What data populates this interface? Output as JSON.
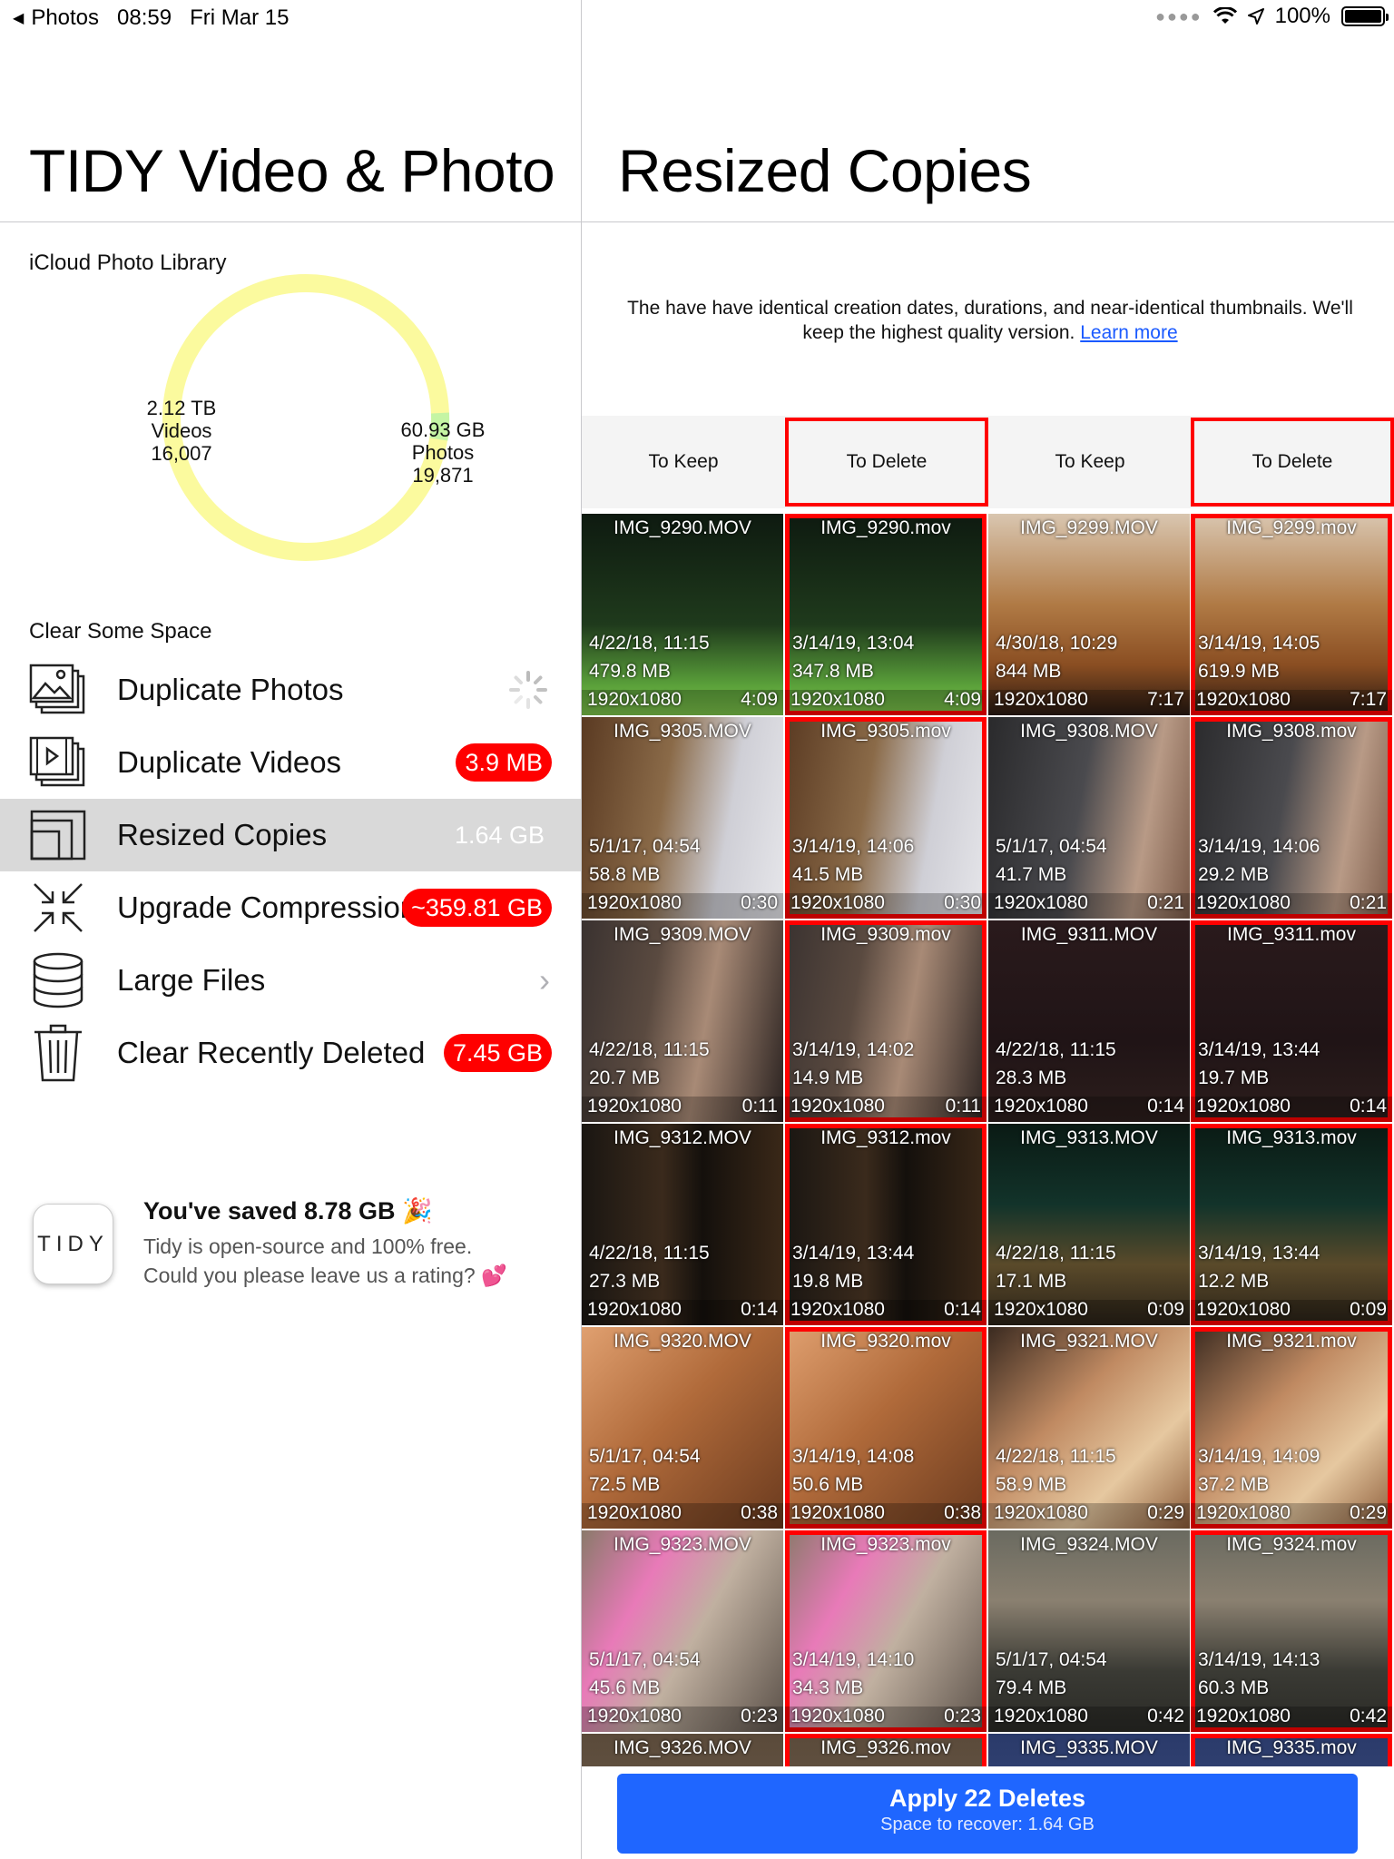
{
  "statusbar": {
    "back_app": "Photos",
    "time": "08:59",
    "date": "Fri Mar 15",
    "battery": "100%"
  },
  "left": {
    "title": "TIDY Video & Photo",
    "library_label": "iCloud Photo Library",
    "donut": {
      "videos_size": "2.12 TB",
      "videos_label": "Videos",
      "videos_count": "16,007",
      "photos_size": "60.93 GB",
      "photos_label": "Photos",
      "photos_count": "19,871",
      "colors": {
        "videos": "#fbfa9e",
        "photos": "#c5f5a4"
      }
    },
    "section_label": "Clear Some Space",
    "menu": [
      {
        "label": "Duplicate Photos",
        "badge": "",
        "icon": "photo-stack-icon"
      },
      {
        "label": "Duplicate Videos",
        "badge": "3.9 MB",
        "icon": "video-stack-icon"
      },
      {
        "label": "Resized Copies",
        "badge": "1.64 GB",
        "icon": "resize-icon"
      },
      {
        "label": "Upgrade Compression",
        "badge": "~359.81 GB",
        "icon": "compress-icon"
      },
      {
        "label": "Large Files",
        "badge": "",
        "icon": "database-icon"
      },
      {
        "label": "Clear Recently Deleted",
        "badge": "7.45 GB",
        "icon": "trash-icon"
      }
    ],
    "rating": {
      "logo_text": "TIDY",
      "title": "You've saved 8.78 GB 🎉",
      "line1": "Tidy is open-source and 100% free.",
      "line2": "Could you please leave us a rating? 💕"
    }
  },
  "right": {
    "title": "Resized Copies",
    "description": "The have have identical creation dates, durations, and near-identical thumbnails. We'll keep the highest quality version.",
    "learn_more": "Learn more",
    "columns": [
      "To Keep",
      "To Delete",
      "To Keep",
      "To Delete"
    ],
    "tiles": [
      {
        "name": "IMG_9290.MOV",
        "date": "4/22/18, 11:15",
        "size": "479.8 MB",
        "res": "1920x1080",
        "dur": "4:09",
        "del": false,
        "bg": "linear-gradient(180deg,#0e1a10 0%,#1f3a1c 55%,#5aa03a 85%,#7cc24a 100%)"
      },
      {
        "name": "IMG_9290.mov",
        "date": "3/14/19, 13:04",
        "size": "347.8 MB",
        "res": "1920x1080",
        "dur": "4:09",
        "del": true,
        "bg": "linear-gradient(180deg,#0e1a10 0%,#1f3a1c 55%,#5aa03a 85%,#7cc24a 100%)"
      },
      {
        "name": "IMG_9299.MOV",
        "date": "4/30/18, 10:29",
        "size": "844 MB",
        "res": "1920x1080",
        "dur": "7:17",
        "del": false,
        "bg": "linear-gradient(180deg,#d9c6b0 0%,#b07a45 45%,#8a4e22 75%,#2a1a12 100%)"
      },
      {
        "name": "IMG_9299.mov",
        "date": "3/14/19, 14:05",
        "size": "619.9 MB",
        "res": "1920x1080",
        "dur": "7:17",
        "del": true,
        "bg": "linear-gradient(180deg,#d9c6b0 0%,#b07a45 45%,#8a4e22 75%,#2a1a12 100%)"
      },
      {
        "name": "IMG_9305.MOV",
        "date": "5/1/17, 04:54",
        "size": "58.8 MB",
        "res": "1920x1080",
        "dur": "0:30",
        "del": false,
        "bg": "linear-gradient(100deg,#5a3a22 0%,#8a6a48 40%,#cfcfd6 70%,#e6e6ea 100%)"
      },
      {
        "name": "IMG_9305.mov",
        "date": "3/14/19, 14:06",
        "size": "41.5 MB",
        "res": "1920x1080",
        "dur": "0:30",
        "del": true,
        "bg": "linear-gradient(100deg,#5a3a22 0%,#8a6a48 40%,#cfcfd6 70%,#e6e6ea 100%)"
      },
      {
        "name": "IMG_9308.MOV",
        "date": "5/1/17, 04:54",
        "size": "41.7 MB",
        "res": "1920x1080",
        "dur": "0:21",
        "del": false,
        "bg": "linear-gradient(100deg,#2a2a2c 0%,#4a4a4e 45%,#b89a86 75%,#7a5a48 100%)"
      },
      {
        "name": "IMG_9308.mov",
        "date": "3/14/19, 14:06",
        "size": "29.2 MB",
        "res": "1920x1080",
        "dur": "0:21",
        "del": true,
        "bg": "linear-gradient(100deg,#2a2a2c 0%,#4a4a4e 45%,#b89a86 75%,#7a5a48 100%)"
      },
      {
        "name": "IMG_9309.MOV",
        "date": "4/22/18, 11:15",
        "size": "20.7 MB",
        "res": "1920x1080",
        "dur": "0:11",
        "del": false,
        "bg": "linear-gradient(100deg,#3a3230 0%,#5a4a40 35%,#a88a76 60%,#2a2220 100%)"
      },
      {
        "name": "IMG_9309.mov",
        "date": "3/14/19, 14:02",
        "size": "14.9 MB",
        "res": "1920x1080",
        "dur": "0:11",
        "del": true,
        "bg": "linear-gradient(100deg,#3a3230 0%,#5a4a40 35%,#a88a76 60%,#2a2220 100%)"
      },
      {
        "name": "IMG_9311.MOV",
        "date": "4/22/18, 11:15",
        "size": "28.3 MB",
        "res": "1920x1080",
        "dur": "0:14",
        "del": false,
        "bg": "linear-gradient(180deg,#2a1a1c 0%,#201416 60%,#2c1e1c 100%)"
      },
      {
        "name": "IMG_9311.mov",
        "date": "3/14/19, 13:44",
        "size": "19.7 MB",
        "res": "1920x1080",
        "dur": "0:14",
        "del": true,
        "bg": "linear-gradient(180deg,#2a1a1c 0%,#201416 60%,#2c1e1c 100%)"
      },
      {
        "name": "IMG_9312.MOV",
        "date": "4/22/18, 11:15",
        "size": "27.3 MB",
        "res": "1920x1080",
        "dur": "0:14",
        "del": false,
        "bg": "linear-gradient(90deg,#1a1612 0%,#3a2a1c 40%,#14100c 60%,#3a2818 100%)"
      },
      {
        "name": "IMG_9312.mov",
        "date": "3/14/19, 13:44",
        "size": "19.8 MB",
        "res": "1920x1080",
        "dur": "0:14",
        "del": true,
        "bg": "linear-gradient(90deg,#1a1612 0%,#3a2a1c 40%,#14100c 60%,#3a2818 100%)"
      },
      {
        "name": "IMG_9313.MOV",
        "date": "4/22/18, 11:15",
        "size": "17.1 MB",
        "res": "1920x1080",
        "dur": "0:09",
        "del": false,
        "bg": "linear-gradient(180deg,#0a1a14 0%,#12332a 40%,#5a4a2a 70%,#2a2218 100%)"
      },
      {
        "name": "IMG_9313.mov",
        "date": "3/14/19, 13:44",
        "size": "12.2 MB",
        "res": "1920x1080",
        "dur": "0:09",
        "del": true,
        "bg": "linear-gradient(180deg,#0a1a14 0%,#12332a 40%,#5a4a2a 70%,#2a2218 100%)"
      },
      {
        "name": "IMG_9320.MOV",
        "date": "5/1/17, 04:54",
        "size": "72.5 MB",
        "res": "1920x1080",
        "dur": "0:38",
        "del": false,
        "bg": "linear-gradient(135deg,#e0a070 0%,#b06a3a 45%,#6a3a1e 100%)"
      },
      {
        "name": "IMG_9320.mov",
        "date": "3/14/19, 14:08",
        "size": "50.6 MB",
        "res": "1920x1080",
        "dur": "0:38",
        "del": true,
        "bg": "linear-gradient(135deg,#e0a070 0%,#b06a3a 45%,#6a3a1e 100%)"
      },
      {
        "name": "IMG_9321.MOV",
        "date": "4/22/18, 11:15",
        "size": "58.9 MB",
        "res": "1920x1080",
        "dur": "0:29",
        "del": false,
        "bg": "linear-gradient(135deg,#3a2a20 0%,#c08a62 40%,#e6c8a0 70%,#8a5a38 100%)"
      },
      {
        "name": "IMG_9321.mov",
        "date": "3/14/19, 14:09",
        "size": "37.2 MB",
        "res": "1920x1080",
        "dur": "0:29",
        "del": true,
        "bg": "linear-gradient(135deg,#3a2a20 0%,#c08a62 40%,#e6c8a0 70%,#8a5a38 100%)"
      },
      {
        "name": "IMG_9323.MOV",
        "date": "5/1/17, 04:54",
        "size": "45.6 MB",
        "res": "1920x1080",
        "dur": "0:23",
        "del": false,
        "bg": "linear-gradient(120deg,#8a7a6a 0%,#e87ab8 30%,#c0b0a0 55%,#5a5048 100%)"
      },
      {
        "name": "IMG_9323.mov",
        "date": "3/14/19, 14:10",
        "size": "34.3 MB",
        "res": "1920x1080",
        "dur": "0:23",
        "del": true,
        "bg": "linear-gradient(120deg,#8a7a6a 0%,#e87ab8 30%,#c0b0a0 55%,#5a5048 100%)"
      },
      {
        "name": "IMG_9324.MOV",
        "date": "5/1/17, 04:54",
        "size": "79.4 MB",
        "res": "1920x1080",
        "dur": "0:42",
        "del": false,
        "bg": "linear-gradient(180deg,#6a6a60 0%,#8a8070 35%,#3a3a34 70%,#2a2a26 100%)"
      },
      {
        "name": "IMG_9324.mov",
        "date": "3/14/19, 14:13",
        "size": "60.3 MB",
        "res": "1920x1080",
        "dur": "0:42",
        "del": true,
        "bg": "linear-gradient(180deg,#6a6a60 0%,#8a8070 35%,#3a3a34 70%,#2a2a26 100%)"
      },
      {
        "name": "IMG_9326.MOV",
        "date": "",
        "size": "",
        "res": "",
        "dur": "",
        "del": false,
        "bg": "linear-gradient(180deg,#5a4a3a 0%,#7a6a58 100%)"
      },
      {
        "name": "IMG_9326.mov",
        "date": "",
        "size": "",
        "res": "",
        "dur": "",
        "del": true,
        "bg": "linear-gradient(180deg,#5a4a3a 0%,#7a6a58 100%)"
      },
      {
        "name": "IMG_9335.MOV",
        "date": "",
        "size": "",
        "res": "",
        "dur": "",
        "del": false,
        "bg": "linear-gradient(180deg,#2a3a6a 0%,#4a5a8a 100%)"
      },
      {
        "name": "IMG_9335.mov",
        "date": "",
        "size": "",
        "res": "",
        "dur": "",
        "del": true,
        "bg": "linear-gradient(180deg,#2a3a6a 0%,#4a5a8a 100%)"
      }
    ],
    "apply": {
      "label": "Apply 22 Deletes",
      "sub_prefix": "Space to recover:",
      "sub_value": "1.64 GB"
    }
  }
}
